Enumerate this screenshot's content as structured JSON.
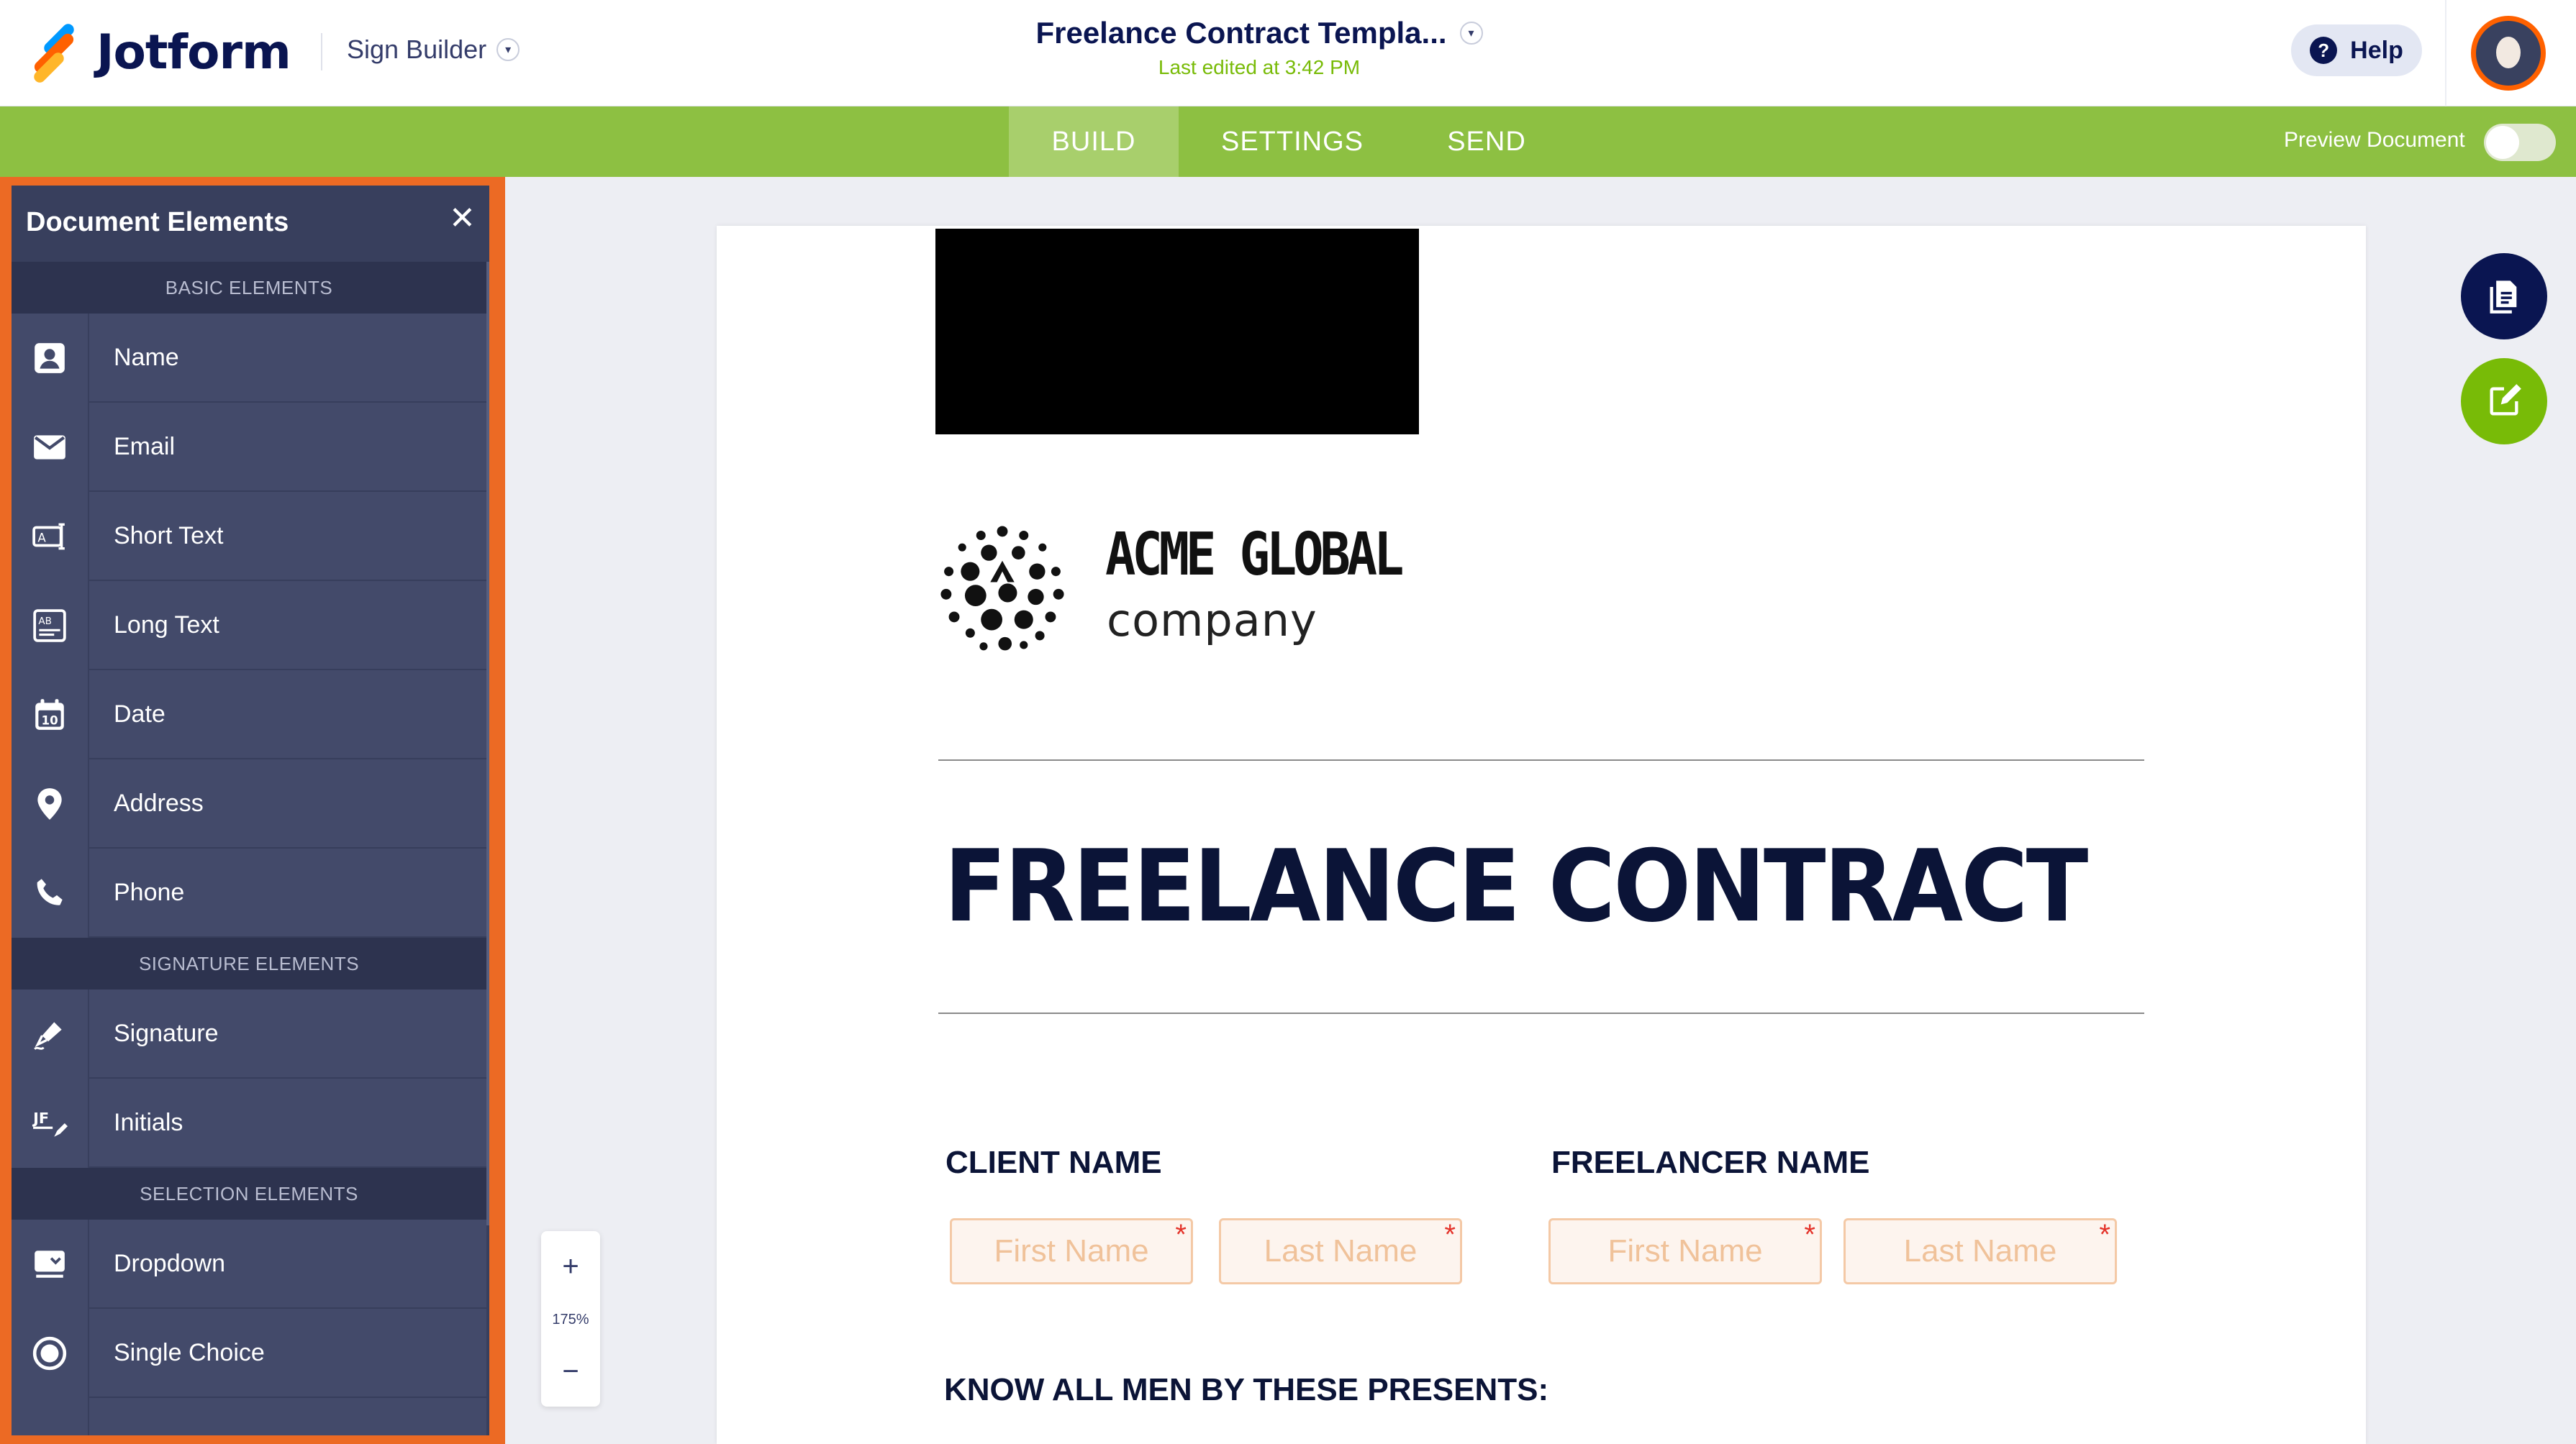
{
  "app": {
    "brand": "Jotform",
    "builder_label": "Sign Builder",
    "document_title": "Freelance Contract Templa...",
    "last_edited": "Last edited at 3:42 PM",
    "help_label": "Help"
  },
  "nav": {
    "tabs": [
      {
        "label": "BUILD",
        "active": true
      },
      {
        "label": "SETTINGS",
        "active": false
      },
      {
        "label": "SEND",
        "active": false
      }
    ],
    "preview_label": "Preview Document",
    "preview_enabled": false
  },
  "panel": {
    "title": "Document Elements",
    "sections": [
      {
        "title": "BASIC ELEMENTS",
        "items": [
          {
            "label": "Name",
            "icon": "person-card-icon"
          },
          {
            "label": "Email",
            "icon": "envelope-icon"
          },
          {
            "label": "Short Text",
            "icon": "short-text-icon"
          },
          {
            "label": "Long Text",
            "icon": "long-text-icon"
          },
          {
            "label": "Date",
            "icon": "calendar-icon"
          },
          {
            "label": "Address",
            "icon": "location-pin-icon"
          },
          {
            "label": "Phone",
            "icon": "phone-icon"
          }
        ]
      },
      {
        "title": "SIGNATURE ELEMENTS",
        "items": [
          {
            "label": "Signature",
            "icon": "pen-nib-icon"
          },
          {
            "label": "Initials",
            "icon": "initials-icon"
          }
        ]
      },
      {
        "title": "SELECTION ELEMENTS",
        "items": [
          {
            "label": "Dropdown",
            "icon": "dropdown-icon"
          },
          {
            "label": "Single Choice",
            "icon": "radio-icon"
          }
        ]
      }
    ]
  },
  "zoom": {
    "in_label": "+",
    "out_label": "−",
    "level": "175%"
  },
  "document": {
    "logo_line1": "ACME GLOBAL",
    "logo_line2": "company",
    "title": "FREELANCE CONTRACT",
    "client_label": "CLIENT NAME",
    "freelancer_label": "FREELANCER NAME",
    "first_name_placeholder": "First Name",
    "last_name_placeholder": "Last Name",
    "required_mark": "*",
    "presents_heading": "KNOW ALL MEN BY THESE PRESENTS:"
  },
  "colors": {
    "nav_green": "#8dc042",
    "panel_border": "#ec6a24",
    "panel_bg": "#383f5d",
    "fab_navy": "#0a1551",
    "fab_green": "#78bb07"
  }
}
